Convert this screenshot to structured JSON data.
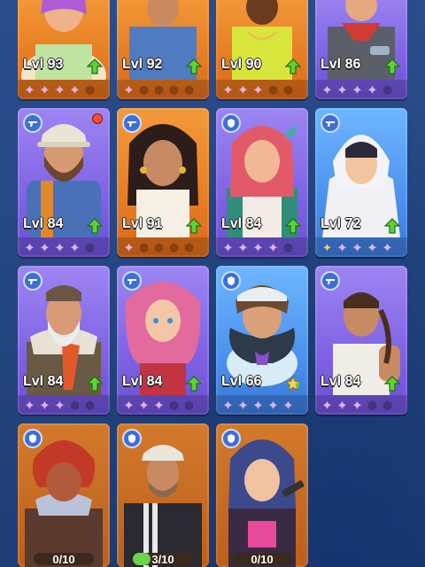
{
  "heroes": [
    {
      "level_label": "Lvl 93",
      "stars": 4,
      "star_total": 5,
      "upgrade": true,
      "rarity": "orange"
    },
    {
      "level_label": "Lvl 92",
      "stars": 1,
      "star_total": 5,
      "upgrade": true,
      "rarity": "orange"
    },
    {
      "level_label": "Lvl 90",
      "stars": 3,
      "star_total": 5,
      "upgrade": true,
      "rarity": "orange"
    },
    {
      "level_label": "Lvl 86",
      "stars": 4,
      "star_total": 5,
      "upgrade": true,
      "rarity": "purple"
    },
    {
      "level_label": "Lvl 84",
      "stars": 4,
      "star_total": 5,
      "upgrade": true,
      "rarity": "purple",
      "notification": true
    },
    {
      "level_label": "Lvl 91",
      "stars": 1,
      "star_total": 5,
      "upgrade": true,
      "rarity": "orange"
    },
    {
      "level_label": "Lvl 84",
      "stars": 4,
      "star_total": 5,
      "upgrade": true,
      "rarity": "purple"
    },
    {
      "level_label": "Lvl 72",
      "stars": 5,
      "star_total": 5,
      "upgrade": true,
      "rarity": "blue",
      "gold_first": true
    },
    {
      "level_label": "Lvl 84",
      "stars": 3,
      "star_total": 5,
      "upgrade": true,
      "rarity": "purple"
    },
    {
      "level_label": "Lvl 84",
      "stars": 3,
      "star_total": 5,
      "upgrade": true,
      "rarity": "purple"
    },
    {
      "level_label": "Lvl 66",
      "stars": 5,
      "star_total": 5,
      "upgrade": true,
      "rarity": "blue"
    },
    {
      "level_label": "Lvl 84",
      "stars": 3,
      "star_total": 5,
      "upgrade": true,
      "rarity": "purple"
    }
  ],
  "locked_heroes": [
    {
      "progress_label": "0/10",
      "progress": 0.0
    },
    {
      "progress_label": "3/10",
      "progress": 0.3
    },
    {
      "progress_label": "0/10",
      "progress": 0.0
    }
  ],
  "colors": {
    "background": "#1f3f7a",
    "star_on": "#e6b3ff",
    "upgrade": "#5fd23a"
  }
}
